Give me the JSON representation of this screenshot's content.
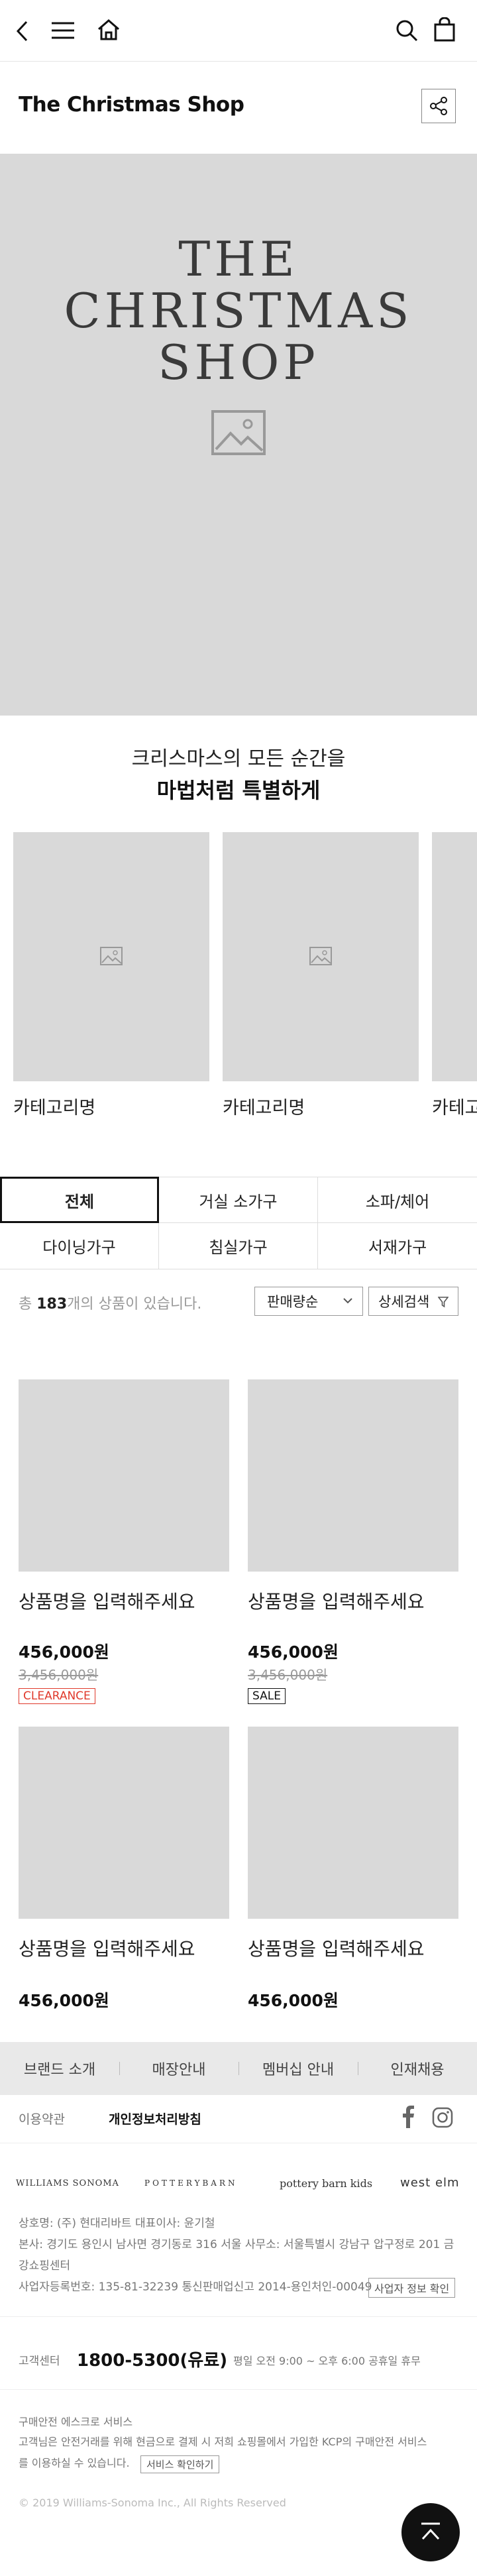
{
  "header": {
    "page_title": "The Christmas Shop",
    "icons": [
      "back-icon",
      "menu-icon",
      "home-icon",
      "search-icon",
      "cart-icon",
      "share-icon"
    ]
  },
  "hero": {
    "title_line1": "THE CHRISTMAS",
    "title_line2": "SHOP",
    "background": "#d9d9d9"
  },
  "tagline": {
    "line1": "크리스마스의 모든 순간을",
    "line2": "마법처럼 특별하게"
  },
  "categories": [
    {
      "label": "카테고리명"
    },
    {
      "label": "카테고리명"
    },
    {
      "label": "카테고리명"
    }
  ],
  "tabs": [
    "전체",
    "거실 소가구",
    "소파/체어",
    "다이닝가구",
    "침실가구",
    "서재가구"
  ],
  "listing": {
    "count_prefix": "총 ",
    "count": "183",
    "count_suffix": "개의 상품이 있습니다.",
    "sort_label": "판매량순",
    "filter_label": "상세검색"
  },
  "products": [
    {
      "name": "상품명을 입력해주세요",
      "price": "456,000원",
      "old_price": "3,456,000원",
      "badge": "CLEARANCE"
    },
    {
      "name": "상품명을 입력해주세요",
      "price": "456,000원",
      "old_price": "3,456,000원",
      "badge": "SALE"
    },
    {
      "name": "상품명을 입력해주세요",
      "price": "456,000원"
    },
    {
      "name": "상품명을 입력해주세요",
      "price": "456,000원"
    }
  ],
  "footer": {
    "nav": [
      "브랜드 소개",
      "매장안내",
      "멤버십 안내",
      "인재채용"
    ],
    "terms": "이용약관",
    "privacy": "개인정보처리방침",
    "brands": [
      "WILLIAMS SONOMA",
      "POTTERYBARN",
      "pottery barn kids",
      "west elm"
    ],
    "company_line": "상호명: (주) 현대리바트    대표이사: 윤기철",
    "address_line1": "본사: 경기도 용인시 남사면 경기동로 316    서울 사무소: 서울특별시 강남구 압구정로 201 금",
    "address_line2": "강쇼핑센터",
    "biz_line": "사업자등록번호: 135-81-32239    통신판매업신고 2014-용인처인-00049",
    "biz_button": "사업자 정보 확인",
    "cs_label": "고객센터",
    "cs_phone": "1800-5300(유료)",
    "cs_hours": "평일 오전 9:00 ~ 오후 6:00 공휴일 휴무",
    "escrow_title": "구매안전 에스크로 서비스",
    "escrow_line1": "고객님은 안전거래를 위해 현금으로 결제 시 저희 쇼핑몰에서 가입한 KCP의 구매안전 서비스",
    "escrow_line2": "를 이용하실 수 있습니다.",
    "escrow_button": "서비스 확인하기",
    "copyright": "© 2019 Williams-Sonoma Inc., All Rights Reserved"
  }
}
